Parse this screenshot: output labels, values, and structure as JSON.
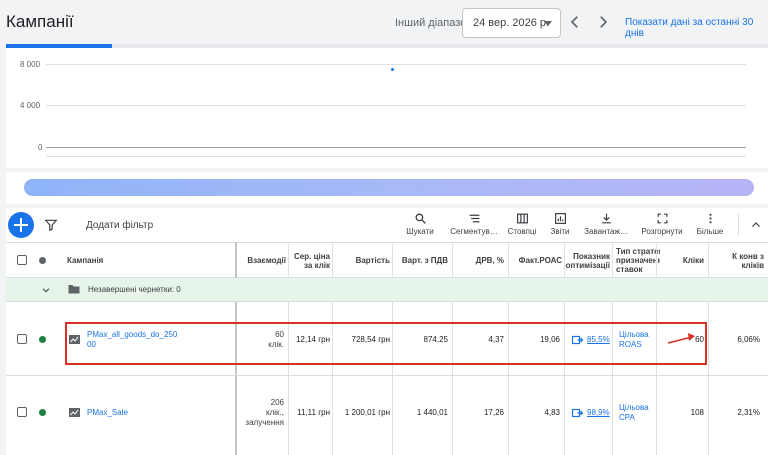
{
  "header": {
    "title": "Кампанії",
    "range_label": "Інший діапазон",
    "date_value": "24 вер. 2026 р.",
    "last30_link": "Показати дані за останні 30 днів"
  },
  "chart": {
    "y_ticks": [
      "8 000",
      "4 000",
      "0"
    ]
  },
  "toolbar": {
    "add_filter": "Додати фільтр",
    "tools": [
      {
        "id": "search",
        "label": "Шукати"
      },
      {
        "id": "segment",
        "label": "Сегментув…"
      },
      {
        "id": "columns",
        "label": "Стовпці"
      },
      {
        "id": "reports",
        "label": "Звіти"
      },
      {
        "id": "download",
        "label": "Завантаж…"
      },
      {
        "id": "expand",
        "label": "Розгорнути"
      },
      {
        "id": "more",
        "label": "Більше"
      }
    ]
  },
  "table": {
    "headers": {
      "campaign": "Кампанія",
      "interactions": "Взаємодії",
      "avg_cpc": "Сер. ціна за клік",
      "cost": "Вартість",
      "conv_value_vat": "Варт. з ПДВ",
      "drv": "ДРВ, %",
      "roas": "Факт.РОАС",
      "opt_score": "Показник оптимізації",
      "bid_strategy": "Тип стратегії призначення ставок",
      "clicks": "Кліки",
      "conv_rate": "К конв з кліків"
    },
    "draft_label": "Незавершені чернетки: 0",
    "rows": [
      {
        "name": "PMax_all_goods_do_25000",
        "name_line1": "PMax_all_goods_do_250",
        "name_line2": "00",
        "interactions_line1": "60",
        "interactions_line2": "клік.",
        "avg_cpc": "12,14 грн",
        "cost": "728,54 грн",
        "conv_value_vat": "874,25",
        "drv": "4,37",
        "roas": "19,06",
        "opt_score": "85,5%",
        "bid_line1": "Цільова",
        "bid_line2": "ROAS",
        "clicks": "60",
        "conv_rate": "6,06%",
        "status_color": "#188038"
      },
      {
        "name": "PMax_Sale",
        "interactions_line1": "206",
        "interactions_line2": "клік.,",
        "interactions_line3": "залучення",
        "avg_cpc": "11,11 грн",
        "cost": "1 200,01 грн",
        "conv_value_vat": "1 440,01",
        "drv": "17,26",
        "roas": "4,83",
        "opt_score": "98,9%",
        "bid_line1": "Цільова",
        "bid_line2": "CPA",
        "clicks": "108",
        "conv_rate": "2,31%",
        "status_color": "#188038"
      }
    ]
  },
  "colors": {
    "accent": "#1a73e8",
    "highlight": "#d93025",
    "draft_bg": "#e6f4ea",
    "enabled": "#188038"
  }
}
